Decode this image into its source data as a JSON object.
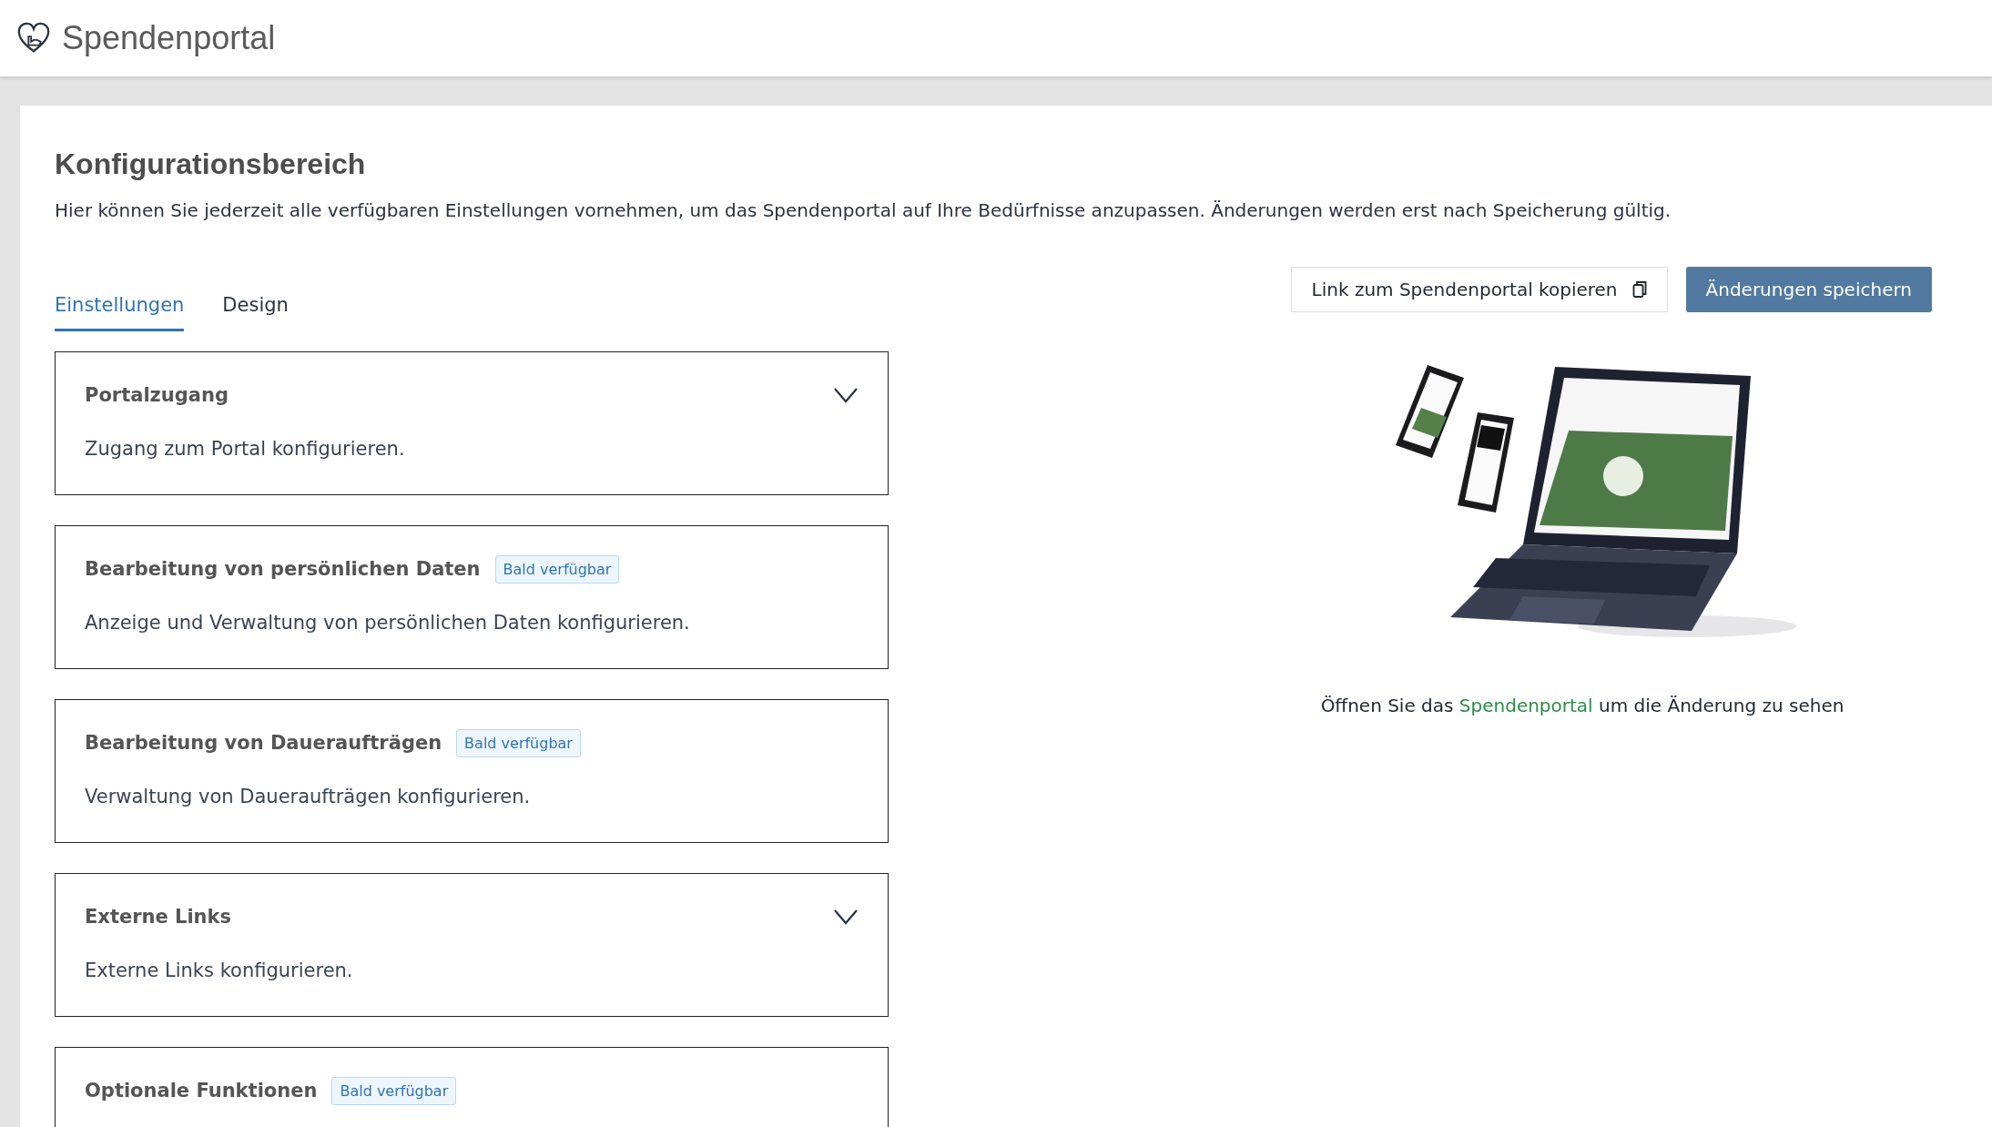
{
  "header": {
    "title": "Spendenportal"
  },
  "page": {
    "title": "Konfigurationsbereich",
    "description": "Hier können Sie jederzeit alle verfügbaren Einstellungen vornehmen, um das Spendenportal auf Ihre Bedürfnisse anzupassen. Änderungen werden erst nach Speicherung gültig."
  },
  "tabs": [
    {
      "label": "Einstellungen",
      "selected": true
    },
    {
      "label": "Design",
      "selected": false
    }
  ],
  "sections": [
    {
      "title": "Portalzugang",
      "description": "Zugang zum Portal konfigurieren.",
      "expandable": true
    },
    {
      "title": "Bearbeitung von persönlichen Daten",
      "badge": "Bald verfügbar",
      "description": "Anzeige und Verwaltung von persönlichen Daten konfigurieren.",
      "expandable": false
    },
    {
      "title": "Bearbeitung von Daueraufträgen",
      "badge": "Bald verfügbar",
      "description": "Verwaltung von Daueraufträgen konfigurieren.",
      "expandable": false
    },
    {
      "title": "Externe Links",
      "description": "Externe Links konfigurieren.",
      "expandable": true
    },
    {
      "title": "Optionale Funktionen",
      "badge": "Bald verfügbar",
      "expandable": false
    }
  ],
  "actions": {
    "copy_link": "Link zum Spendenportal kopieren",
    "save": "Änderungen speichern"
  },
  "preview": {
    "kind": "picture",
    "caption_before": "Öffnen Sie das",
    "caption_link": "Spendenportal",
    "caption_after": "um die Änderung zu sehen"
  }
}
